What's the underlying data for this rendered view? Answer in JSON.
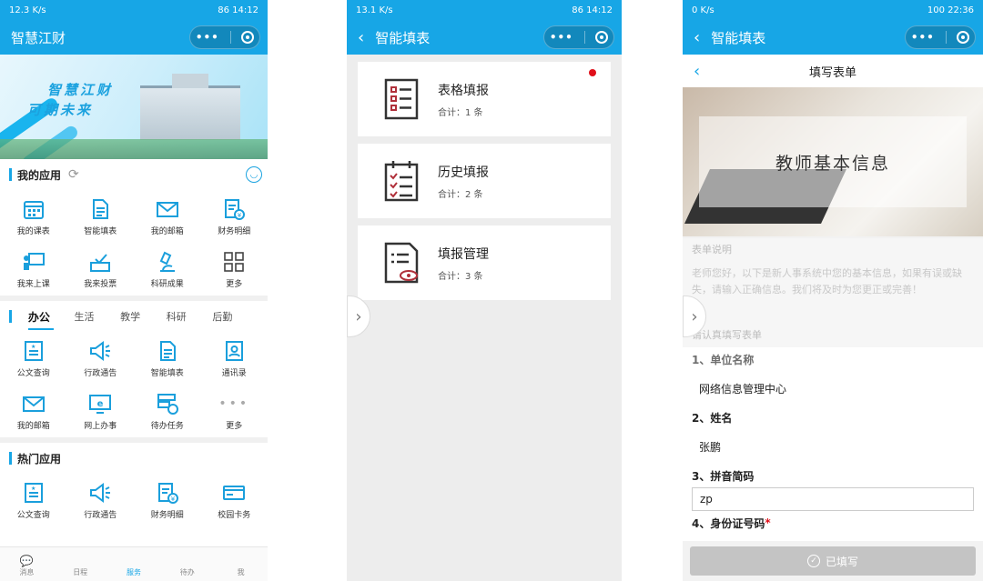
{
  "panel1": {
    "status": {
      "left": "12.3 K/s",
      "battery": "86",
      "time": "14:12"
    },
    "title": "智慧江财",
    "banner": {
      "line1": "智慧江财",
      "line2": "可期未来"
    },
    "my_apps": {
      "heading": "我的应用",
      "items": [
        {
          "label": "我的课表",
          "icon": "calendar-icon"
        },
        {
          "label": "智能填表",
          "icon": "document-icon"
        },
        {
          "label": "我的邮箱",
          "icon": "mail-icon"
        },
        {
          "label": "财务明细",
          "icon": "finance-icon"
        },
        {
          "label": "我来上课",
          "icon": "teaching-icon"
        },
        {
          "label": "我来投票",
          "icon": "vote-icon"
        },
        {
          "label": "科研成果",
          "icon": "microscope-icon"
        },
        {
          "label": "更多",
          "icon": "grid-icon"
        }
      ]
    },
    "tabs": [
      "办公",
      "生活",
      "教学",
      "科研",
      "后勤"
    ],
    "office_apps": [
      {
        "label": "公文查询",
        "icon": "doc-search-icon"
      },
      {
        "label": "行政通告",
        "icon": "megaphone-icon"
      },
      {
        "label": "智能填表",
        "icon": "document-icon"
      },
      {
        "label": "通讯录",
        "icon": "contacts-icon"
      },
      {
        "label": "我的邮箱",
        "icon": "mail-icon"
      },
      {
        "label": "网上办事",
        "icon": "browser-icon"
      },
      {
        "label": "待办任务",
        "icon": "task-icon"
      },
      {
        "label": "更多",
        "icon": "more-dots-icon"
      }
    ],
    "hot_apps": {
      "heading": "热门应用",
      "items": [
        {
          "label": "公文查询",
          "icon": "doc-search-icon"
        },
        {
          "label": "行政通告",
          "icon": "megaphone-icon"
        },
        {
          "label": "财务明细",
          "icon": "finance-icon"
        },
        {
          "label": "校园卡务",
          "icon": "card-icon"
        }
      ]
    },
    "tabbar": [
      {
        "label": "消息",
        "active": false
      },
      {
        "label": "日程",
        "active": false
      },
      {
        "label": "服务",
        "active": true
      },
      {
        "label": "待办",
        "active": false
      },
      {
        "label": "我",
        "active": false
      }
    ]
  },
  "panel2": {
    "status": {
      "left": "13.1 K/s",
      "battery": "86",
      "time": "14:12"
    },
    "title": "智能填表",
    "cards": [
      {
        "title": "表格填报",
        "count": "合计：1 条",
        "badge": true
      },
      {
        "title": "历史填报",
        "count": "合计：2 条",
        "badge": false
      },
      {
        "title": "填报管理",
        "count": "合计：3 条",
        "badge": false
      }
    ]
  },
  "panel3": {
    "status": {
      "left": "0 K/s",
      "battery": "100",
      "time": "22:36"
    },
    "title": "智能填表",
    "subtitle": "填写表单",
    "hero_text": "教师基本信息",
    "desc_heading": "表单说明",
    "desc_text": "老师您好，以下是新人事系统中您的基本信息，如果有误或缺失，请输入正确信息。我们将及时为您更正或完善！",
    "fill_heading": "请认真填写表单",
    "fields": [
      {
        "label": "1、单位名称",
        "value": "网络信息管理中心",
        "input": false
      },
      {
        "label": "2、姓名",
        "value": "张鹏",
        "input": false
      },
      {
        "label": "3、拼音简码",
        "value": "zp",
        "input": true
      }
    ],
    "field4_label": "4、身份证号码",
    "field4_required": "*",
    "submit_label": "已填写"
  }
}
